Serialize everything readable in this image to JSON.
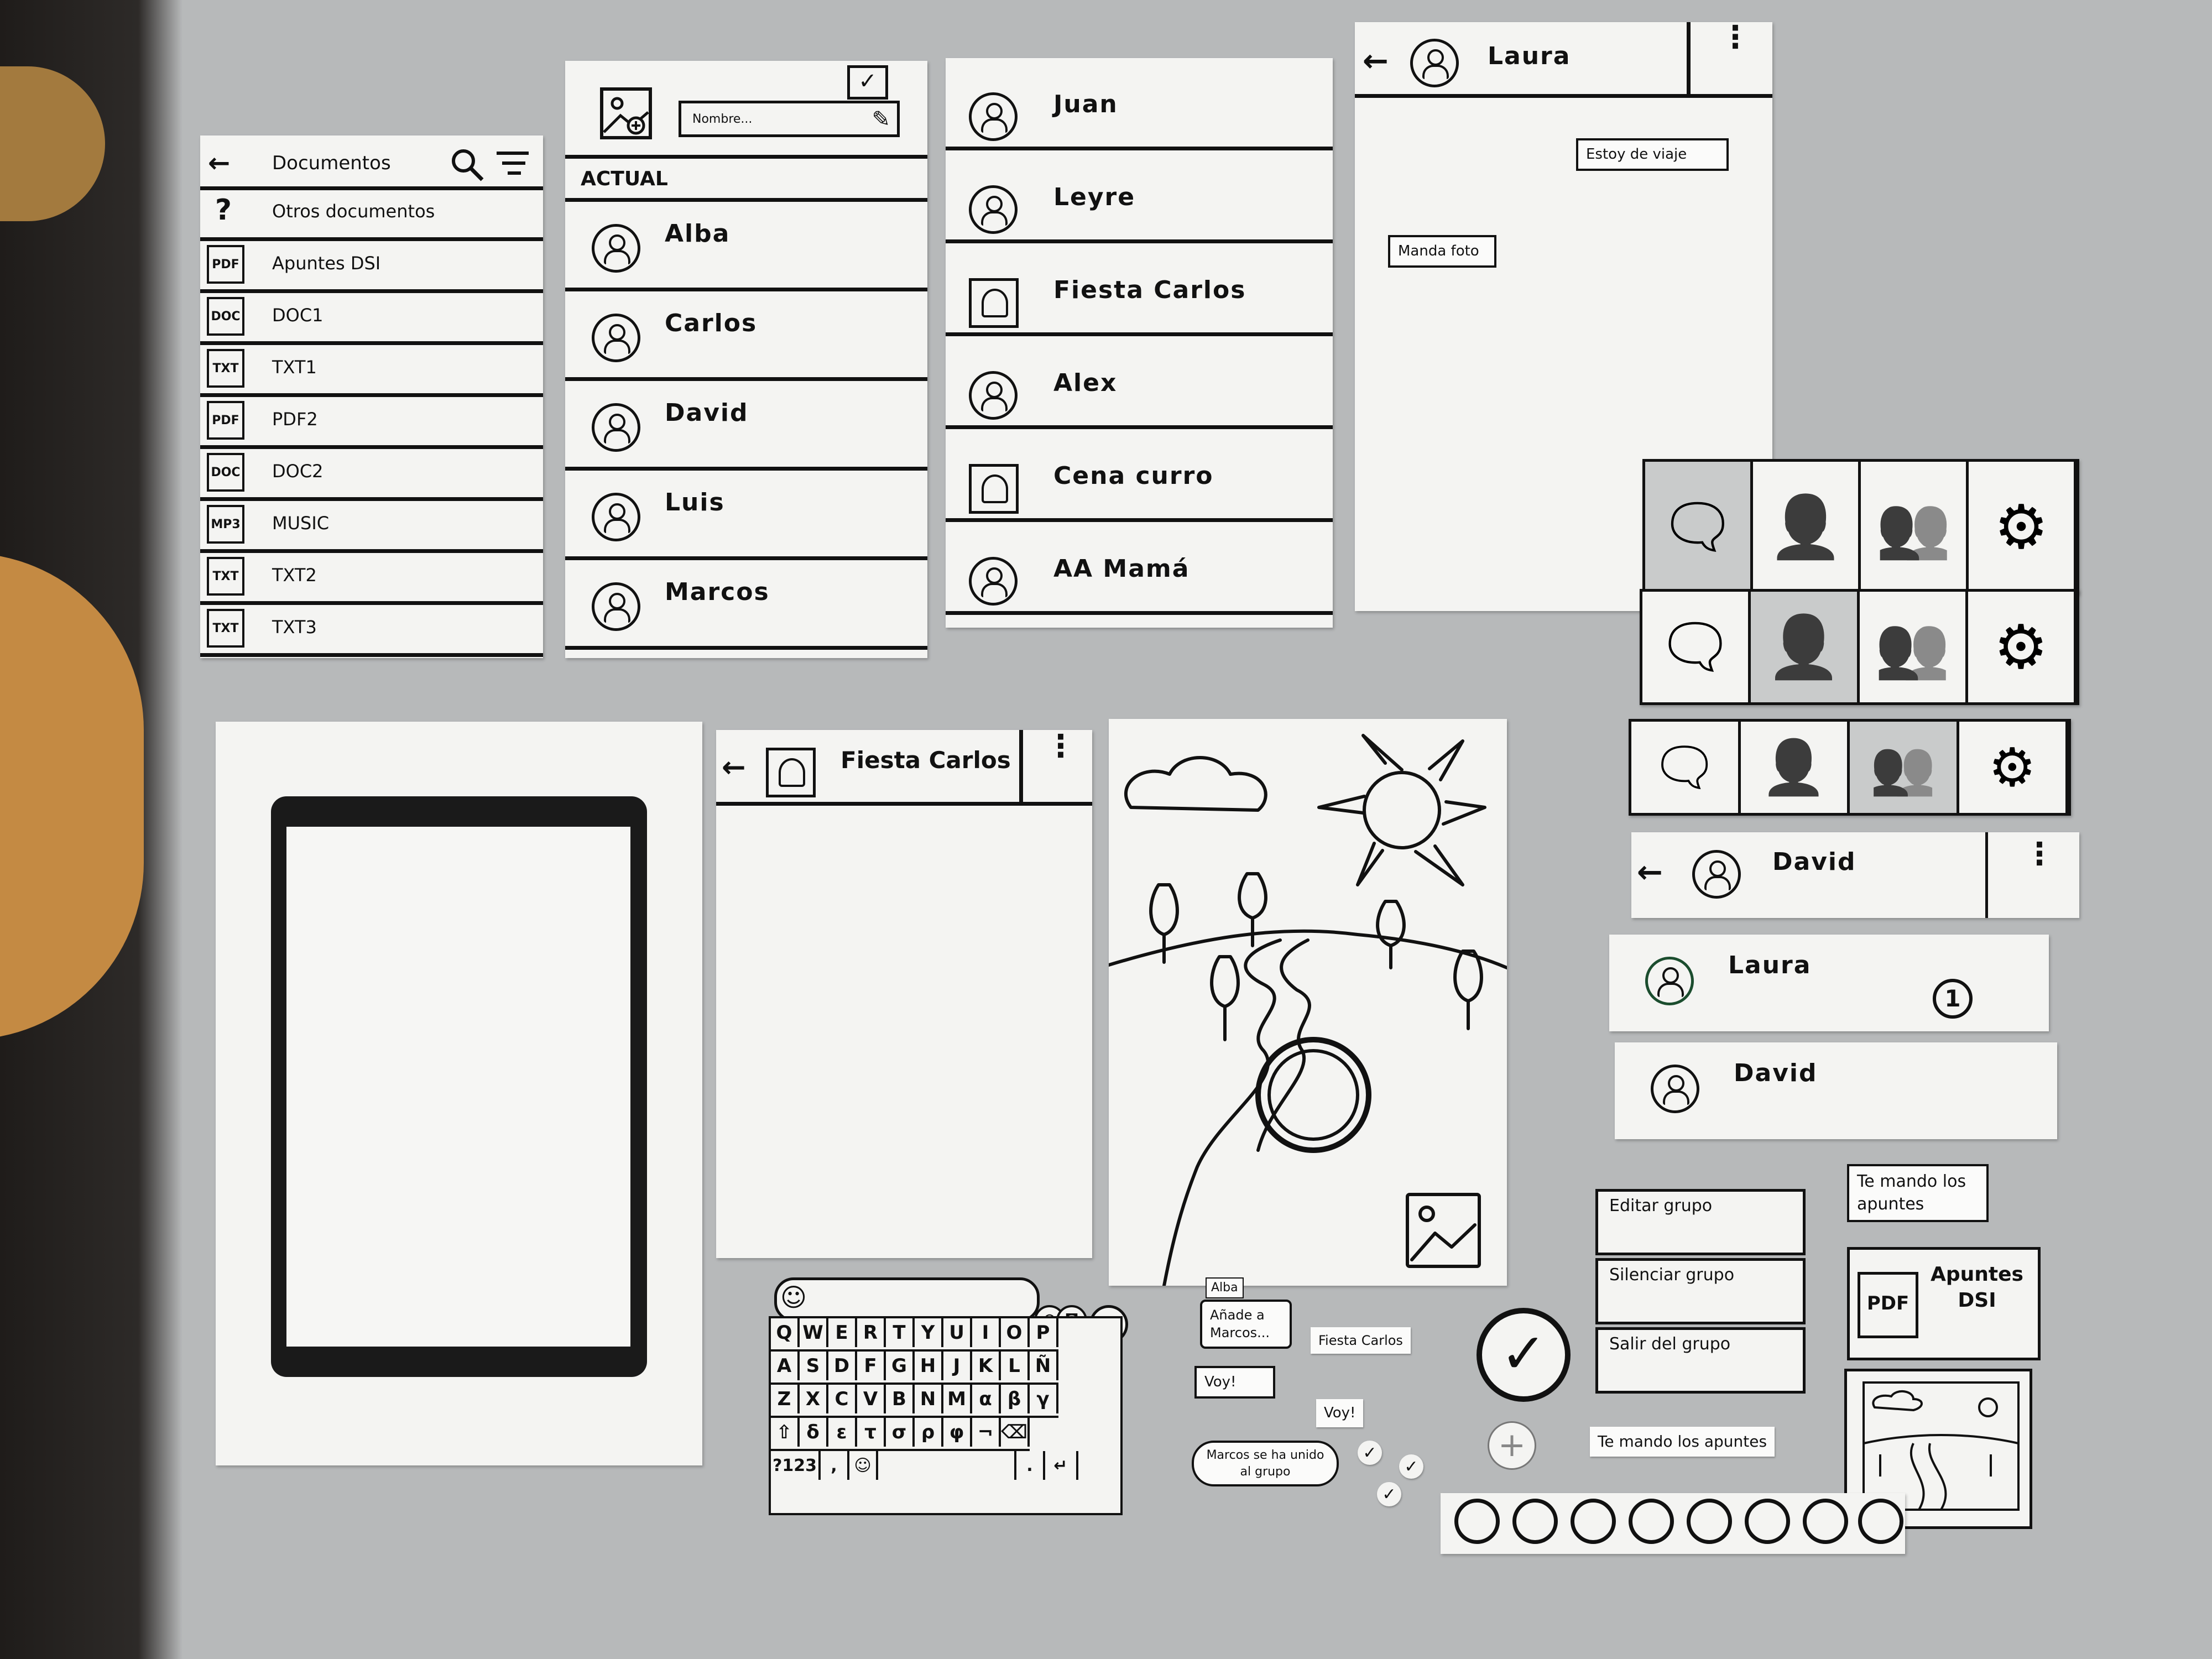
{
  "documents_screen": {
    "title": "Documentos",
    "items": [
      {
        "icon": "?",
        "label": "Otros documentos"
      },
      {
        "icon": "PDF",
        "label": "Apuntes DSI"
      },
      {
        "icon": "DOC",
        "label": "DOC1"
      },
      {
        "icon": "TXT",
        "label": "TXT1"
      },
      {
        "icon": "PDF",
        "label": "PDF2"
      },
      {
        "icon": "DOC",
        "label": "DOC2"
      },
      {
        "icon": "MP3",
        "label": "MUSIC"
      },
      {
        "icon": "TXT",
        "label": "TXT2"
      },
      {
        "icon": "TXT",
        "label": "TXT3"
      }
    ]
  },
  "new_group_screen": {
    "name_placeholder": "Nombre...",
    "section_label": "ACTUAL",
    "contacts": [
      "Alba",
      "Carlos",
      "David",
      "Luis",
      "Marcos"
    ]
  },
  "chat_list_screen": {
    "chats": [
      "Juan",
      "Leyre",
      "Fiesta Carlos",
      "Alex",
      "Cena curro",
      "AA Mamá"
    ]
  },
  "laura_chat": {
    "title": "Laura",
    "messages": [
      {
        "text": "Estoy de viaje"
      },
      {
        "text": "Manda foto"
      }
    ]
  },
  "group_chat": {
    "title": "Fiesta Carlos"
  },
  "david_header": {
    "title": "David"
  },
  "contact_cards": [
    {
      "name": "Laura",
      "badge": "1"
    },
    {
      "name": "David"
    }
  ],
  "keyboard": {
    "rows": [
      [
        "Q",
        "W",
        "E",
        "R",
        "T",
        "Y",
        "U",
        "I",
        "O",
        "P"
      ],
      [
        "A",
        "S",
        "D",
        "F",
        "G",
        "H",
        "J",
        "K",
        "L",
        "Ñ"
      ],
      [
        "Z",
        "X",
        "C",
        "V",
        "B",
        "N",
        "M",
        "α",
        "β",
        "γ"
      ],
      [
        "⇧",
        "δ",
        "ε",
        "τ",
        "σ",
        "ρ",
        "φ",
        "¬",
        "⌫"
      ]
    ],
    "bottom": {
      "sym_label": "?123",
      "comma": ",",
      "period": "."
    }
  },
  "small_notes": {
    "alba_tag": "Alba",
    "alba_msg": "Añade a Marcos...",
    "voy1": "Voy!",
    "voy2": "Voy!",
    "fiesta_label": "Fiesta Carlos",
    "joined": "Marcos se ha unido al grupo",
    "apuntes_note": "Te mando los apuntes"
  },
  "group_menu": {
    "items": [
      "Editar grupo",
      "Silenciar grupo",
      "Salir del grupo"
    ]
  },
  "right_bubbles": {
    "apuntes_msg": "Te mando los apuntes",
    "pdf_icon": "PDF",
    "pdf_name": "Apuntes DSI"
  },
  "colors": {
    "ink": "#111111",
    "paper": "#f4f4f2",
    "table": "#b7b9ba",
    "selected_cell": "#c9cbcb"
  }
}
